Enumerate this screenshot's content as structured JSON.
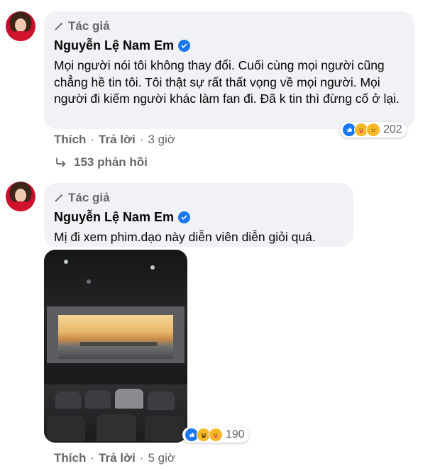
{
  "comments": [
    {
      "author_tag": "Tác giả",
      "author_name": "Nguyễn Lệ Nam Em",
      "text": "Mọi người nói tôi không thay đổi. Cuối cùng mọi người cũng chẳng hề tin tôi. Tôi thật sự rất thất vọng về mọi người. Mọi người đi kiếm người khác làm fan đi. Đã k tin thì đừng cố ở lại.",
      "reactions": {
        "icons": [
          "like-icon",
          "care-icon",
          "sad-icon"
        ],
        "count": "202"
      },
      "actions": {
        "like": "Thích",
        "reply": "Trả lời",
        "time": "3 giờ",
        "separator": "·"
      },
      "replies_label": "153 phản hồi"
    },
    {
      "author_tag": "Tác giả",
      "author_name": "Nguyễn Lệ Nam Em",
      "text": "Mị đi xem phim.dạo này diễn viên diễn giỏi quá.",
      "reactions": {
        "icons": [
          "like-icon",
          "haha-icon",
          "care-icon"
        ],
        "count": "190"
      },
      "actions": {
        "like": "Thích",
        "reply": "Trả lời",
        "time": "5 giờ",
        "separator": "·"
      }
    }
  ],
  "colors": {
    "bubble": "#f0f2f5",
    "muted": "#65676b",
    "verified": "#1877f2",
    "like": "#1877f2",
    "emoji": "#f7b928"
  }
}
